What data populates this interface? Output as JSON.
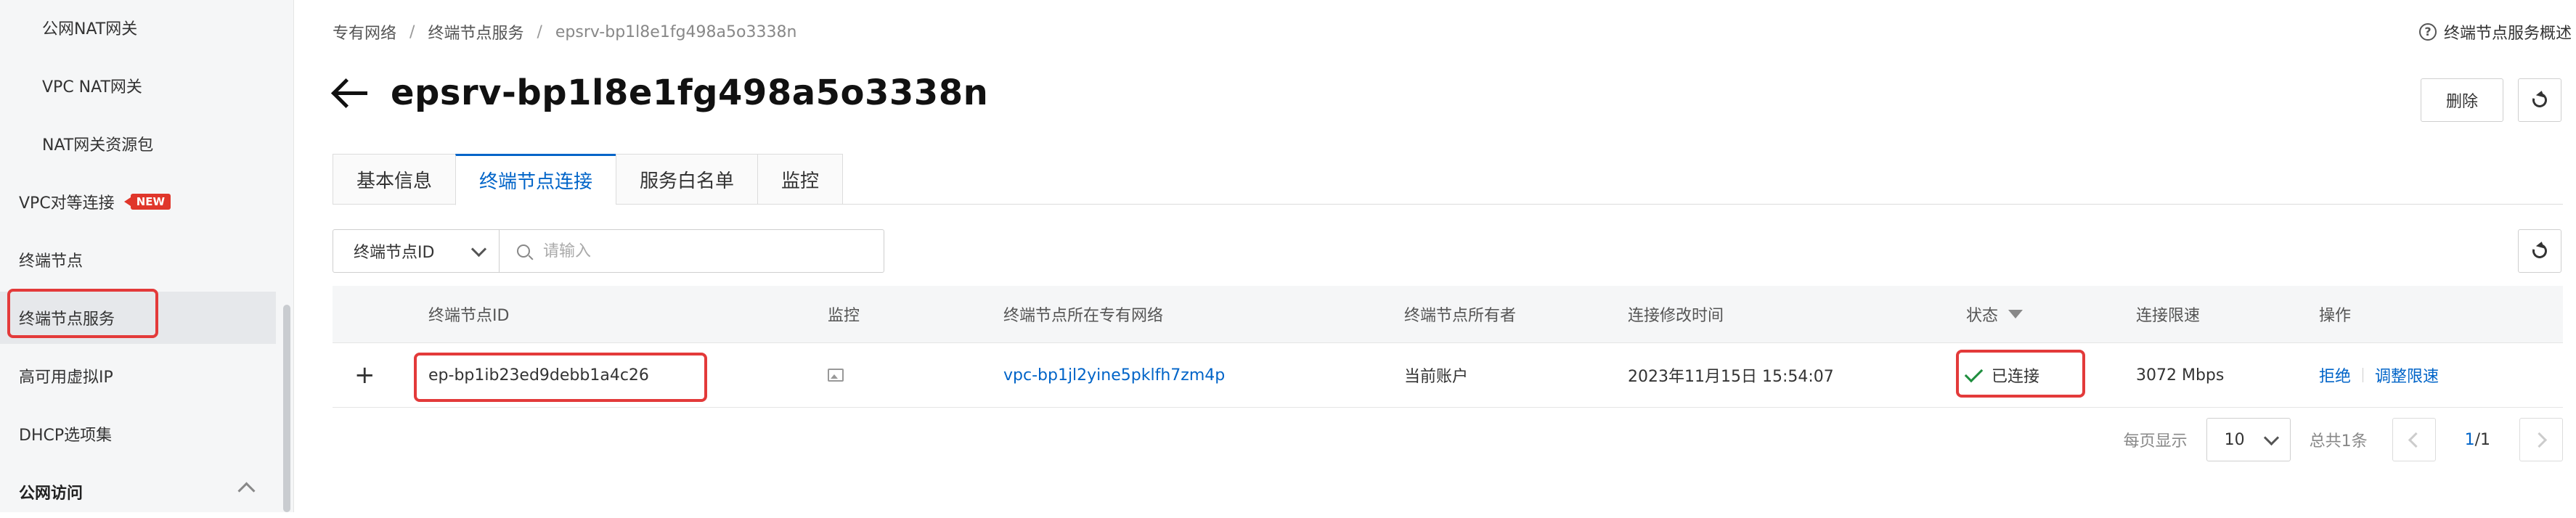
{
  "sidebar": {
    "items": [
      {
        "label": "公网NAT网关"
      },
      {
        "label": "VPC NAT网关"
      },
      {
        "label": "NAT网关资源包"
      },
      {
        "label": "VPC对等连接",
        "badge": "NEW"
      },
      {
        "label": "终端节点"
      },
      {
        "label": "终端节点服务"
      },
      {
        "label": "高可用虚拟IP"
      },
      {
        "label": "DHCP选项集"
      },
      {
        "label": "公网访问"
      }
    ]
  },
  "breadcrumb": {
    "items": [
      "专有网络",
      "终端节点服务",
      "epsrv-bp1l8e1fg498a5o3338n"
    ],
    "separator": "/"
  },
  "help_link": "终端节点服务概述",
  "page": {
    "title": "epsrv-bp1l8e1fg498a5o3338n",
    "delete_label": "删除"
  },
  "tabs": [
    {
      "label": "基本信息"
    },
    {
      "label": "终端节点连接"
    },
    {
      "label": "服务白名单"
    },
    {
      "label": "监控"
    }
  ],
  "search": {
    "field": "终端节点ID",
    "placeholder": "请输入"
  },
  "table": {
    "headers": {
      "id": "终端节点ID",
      "monitor": "监控",
      "vpc": "终端节点所在专有网络",
      "owner": "终端节点所有者",
      "modified": "连接修改时间",
      "status": "状态",
      "bandwidth": "连接限速",
      "actions": "操作"
    },
    "rows": [
      {
        "id": "ep-bp1ib23ed9debb1a4c26",
        "vpc": "vpc-bp1jl2yine5pklfh7zm4p",
        "owner": "当前账户",
        "modified": "2023年11月15日 15:54:07",
        "status": "已连接",
        "bandwidth": "3072 Mbps",
        "action_reject": "拒绝",
        "action_adjust": "调整限速"
      }
    ]
  },
  "pagination": {
    "per_page_label": "每页显示",
    "per_page": "10",
    "total": "总共1条",
    "current": "1",
    "pages": "/1"
  },
  "colors": {
    "accent": "#0064c8",
    "highlight": "#e33a3a",
    "success": "#1e8e3e"
  }
}
